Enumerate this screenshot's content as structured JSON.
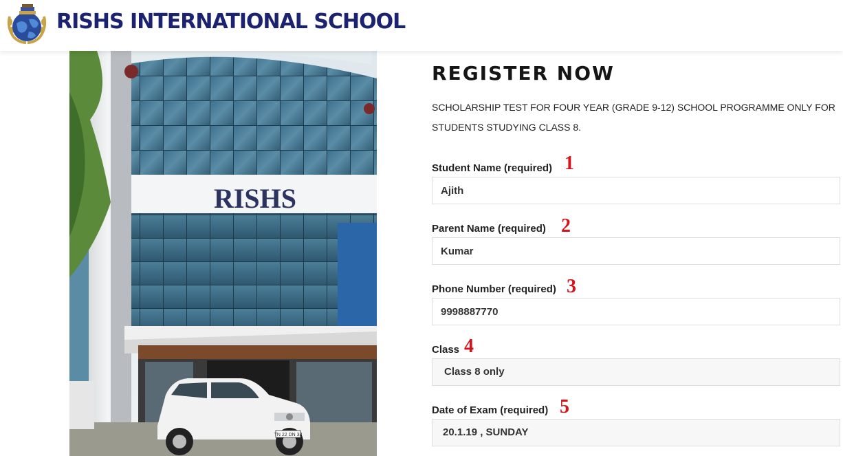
{
  "header": {
    "brand": "RISHS INTERNATIONAL SCHOOL",
    "logo_icon": "globe-laurel-emblem-icon",
    "brand_color": "#1b2270"
  },
  "hero": {
    "building_sign": "RISHS",
    "car_plate": "TN 22 DN 33"
  },
  "form": {
    "title": "REGISTER NOW",
    "intro": "SCHOLARSHIP TEST FOR FOUR YEAR (GRADE 9-12) SCHOOL PROGRAMME ONLY FOR STUDENTS STUDYING CLASS 8.",
    "fields": [
      {
        "label": "Student Name (required)",
        "value": "Ajith",
        "marker": "1"
      },
      {
        "label": "Parent Name (required)",
        "value": "Kumar",
        "marker": "2"
      },
      {
        "label": "Phone Number (required)",
        "value": "9998887770",
        "marker": "3"
      },
      {
        "label": "Class",
        "value": "Class 8 only",
        "marker": "4"
      },
      {
        "label": "Date of Exam (required)",
        "value": "20.1.19 , SUNDAY",
        "marker": "5"
      }
    ],
    "marker_color": "#d4141c"
  }
}
